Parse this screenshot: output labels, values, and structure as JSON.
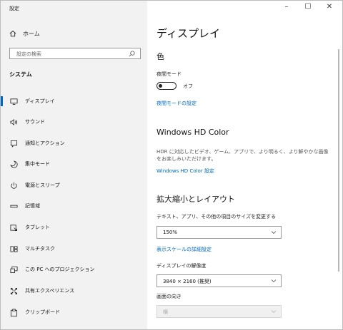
{
  "window": {
    "title": "設定",
    "controls": {
      "minimize": "–",
      "maximize": "☐",
      "close": "✕"
    }
  },
  "sidebar": {
    "home_label": "ホーム",
    "search_placeholder": "設定の検索",
    "section_title": "システム",
    "items": [
      {
        "label": "ディスプレイ",
        "icon": "monitor-icon",
        "active": true
      },
      {
        "label": "サウンド",
        "icon": "speaker-icon"
      },
      {
        "label": "通知とアクション",
        "icon": "notification-icon"
      },
      {
        "label": "集中モード",
        "icon": "moon-icon"
      },
      {
        "label": "電源とスリープ",
        "icon": "power-icon"
      },
      {
        "label": "記憶域",
        "icon": "storage-icon"
      },
      {
        "label": "タブレット",
        "icon": "tablet-icon"
      },
      {
        "label": "マルチタスク",
        "icon": "multitask-icon"
      },
      {
        "label": "この PC へのプロジェクション",
        "icon": "projection-icon"
      },
      {
        "label": "共有エクスペリエンス",
        "icon": "shared-experience-icon"
      },
      {
        "label": "クリップボード",
        "icon": "clipboard-icon"
      }
    ]
  },
  "main": {
    "title": "ディスプレイ",
    "color_section": {
      "heading": "色",
      "night_light_label": "夜間モード",
      "night_light_state": "オフ",
      "night_light_on": false,
      "night_light_link": "夜間モードの設定"
    },
    "hd_color": {
      "heading": "Windows HD Color",
      "desc_line1": "HDR に対応したビデオ、ゲーム、アプリで、より明るく、より鮮やかな画像",
      "desc_line2": "をお楽しみいただけます。",
      "link": "Windows HD Color 設定"
    },
    "scale_layout": {
      "heading": "拡大縮小とレイアウト",
      "scale_label": "テキスト、アプリ、その他の項目のサイズを変更する",
      "scale_value": "150%",
      "advanced_link": "表示スケールの詳細設定",
      "resolution_label": "ディスプレイの解像度",
      "resolution_value": "3840 × 2160 (推奨)",
      "orientation_label": "画面の向き",
      "orientation_value": "横"
    }
  },
  "colors": {
    "accent": "#0067c0",
    "sidebar_bg": "#f2f2f2"
  }
}
